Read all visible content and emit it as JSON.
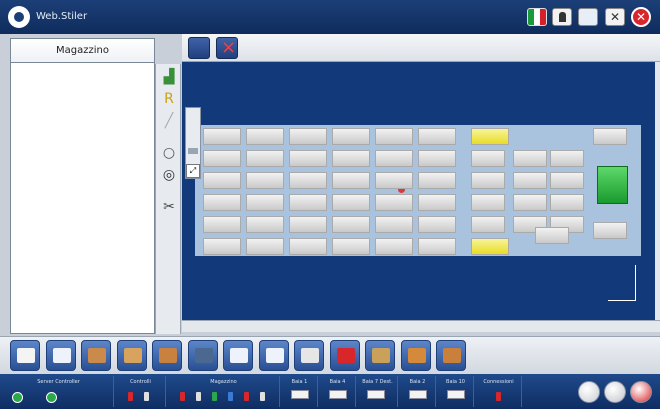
{
  "window": {
    "title": "Web.Stiler"
  },
  "left_panel": {
    "tab_label": "Magazzino"
  },
  "vertical_tools": [
    "add-shelf-icon",
    "tag-icon",
    "line-icon",
    "circle-outline-icon",
    "ring-icon",
    "cut-icon"
  ],
  "map": {
    "zoom_fit_label": "⤢"
  },
  "bottom_toolbar": {
    "buttons": [
      "home-icon",
      "frame-icon",
      "pallet-icon",
      "edit-icon",
      "box-icon",
      "truck-icon",
      "list-icon",
      "calendar-icon",
      "forklift-icon",
      "alarm-icon",
      "boxes-icon",
      "stack-icon",
      "export-icon"
    ]
  },
  "statusbar": {
    "groups": [
      {
        "label": "Server   Controller"
      },
      {
        "label": "Controlli"
      },
      {
        "label": "Magazzino"
      },
      {
        "label": "Baia 1"
      },
      {
        "label": "Baia 4"
      },
      {
        "label": "Baia 7 Dest."
      },
      {
        "label": "Baia 2"
      },
      {
        "label": "Baia 10"
      },
      {
        "label": "Connessioni"
      }
    ]
  },
  "colors": {
    "title_bar": "#1c3f78",
    "map_bg": "#123a7a",
    "layout_bg": "#a9c2de",
    "highlight_yellow": "#e9dc26",
    "highlight_green": "#1a9a2d",
    "alert_red": "#d8262b"
  }
}
